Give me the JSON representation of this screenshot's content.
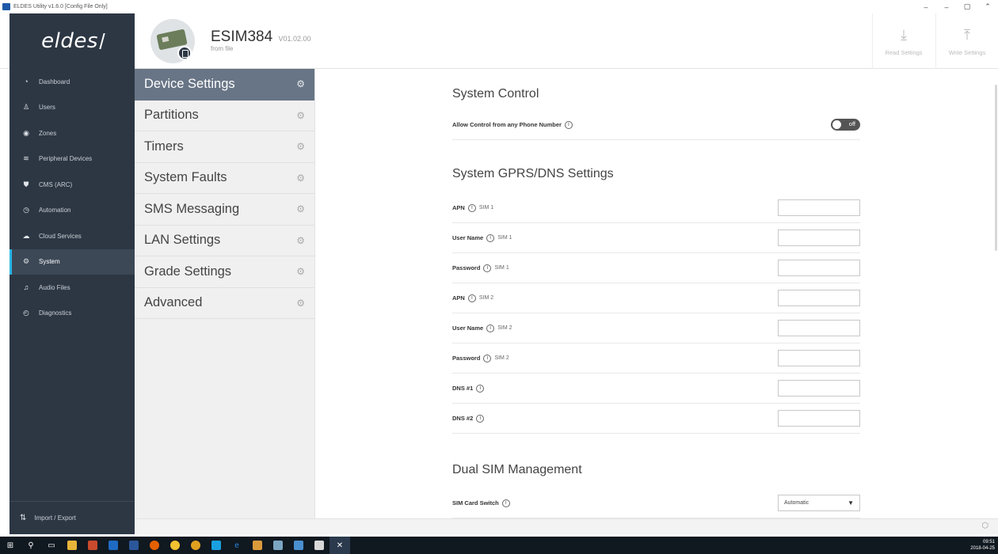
{
  "window": {
    "title": "ELDES Utility v1.6.0 [Config File Only]",
    "controls": [
      "–",
      "–",
      "▢",
      "⌃"
    ]
  },
  "header": {
    "logo": "eldes",
    "device_name": "ESIM384",
    "device_version": "V01.02.00",
    "device_source": "from file",
    "read_settings_label": "Read Settings",
    "write_settings_label": "Write Settings"
  },
  "sidebar": {
    "items": [
      {
        "label": "Dashboard",
        "icon": "dashboard-icon"
      },
      {
        "label": "Users",
        "icon": "user-icon"
      },
      {
        "label": "Zones",
        "icon": "location-pin-icon"
      },
      {
        "label": "Peripheral Devices",
        "icon": "wifi-icon"
      },
      {
        "label": "CMS (ARC)",
        "icon": "shield-icon"
      },
      {
        "label": "Automation",
        "icon": "clock-icon"
      },
      {
        "label": "Cloud Services",
        "icon": "cloud-icon"
      },
      {
        "label": "System",
        "icon": "gear-icon"
      },
      {
        "label": "Audio Files",
        "icon": "music-note-icon"
      },
      {
        "label": "Diagnostics",
        "icon": "gauge-icon"
      }
    ],
    "active": "System",
    "import_export_label": "Import / Export"
  },
  "submenu": {
    "items": [
      "Device Settings",
      "Partitions",
      "Timers",
      "System Faults",
      "SMS Messaging",
      "LAN Settings",
      "Grade Settings",
      "Advanced"
    ],
    "active": "Device Settings"
  },
  "main": {
    "system_control": {
      "title": "System Control",
      "allow_control_label": "Allow Control from any Phone Number",
      "allow_control_state": "off"
    },
    "gprs": {
      "title": "System GPRS/DNS Settings",
      "rows": [
        {
          "label": "APN",
          "sub": "SIM 1",
          "value": ""
        },
        {
          "label": "User Name",
          "sub": "SIM 1",
          "value": ""
        },
        {
          "label": "Password",
          "sub": "SIM 1",
          "value": ""
        },
        {
          "label": "APN",
          "sub": "SIM 2",
          "value": ""
        },
        {
          "label": "User Name",
          "sub": "SIM 2",
          "value": ""
        },
        {
          "label": "Password",
          "sub": "SIM 2",
          "value": ""
        },
        {
          "label": "DNS #1",
          "sub": "",
          "value": ""
        },
        {
          "label": "DNS #2",
          "sub": "",
          "value": ""
        }
      ]
    },
    "dual_sim": {
      "title": "Dual SIM Management",
      "sim_switch_label": "SIM Card Switch",
      "sim_switch_value": "Automatic"
    }
  },
  "taskbar": {
    "time": "09:51",
    "date": "2018-04-25"
  },
  "colors": {
    "sidebar_bg": "#2d3744",
    "accent": "#27b6e7",
    "submenu_active": "#687586"
  }
}
